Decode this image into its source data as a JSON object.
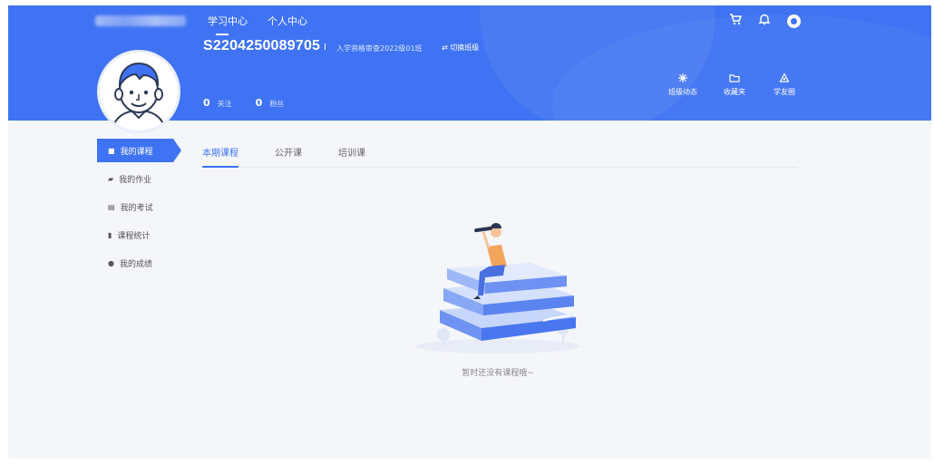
{
  "header": {
    "nav": [
      {
        "label": "学习中心"
      },
      {
        "label": "个人中心"
      }
    ],
    "username": "S2204250089705",
    "separator": "I",
    "class_name": "入学资格审查2022级01班",
    "switch_label": "⇄ 切换班级",
    "stats": [
      {
        "value": "0",
        "label": "关注"
      },
      {
        "value": "0",
        "label": "粉丝"
      }
    ],
    "quick_links": [
      {
        "label": "班级动态",
        "icon": "class-activity-icon"
      },
      {
        "label": "收藏夹",
        "icon": "folder-icon"
      },
      {
        "label": "学友圈",
        "icon": "friends-circle-icon"
      }
    ],
    "top_icons": [
      "cart-icon",
      "bell-icon",
      "user-avatar-icon"
    ]
  },
  "sidebar": {
    "items": [
      {
        "label": "我的课程",
        "icon": "course-icon"
      },
      {
        "label": "我的作业",
        "icon": "homework-icon"
      },
      {
        "label": "我的考试",
        "icon": "exam-icon"
      },
      {
        "label": "课程统计",
        "icon": "stats-icon"
      },
      {
        "label": "我的成绩",
        "icon": "grade-icon"
      }
    ]
  },
  "tabs": [
    {
      "label": "本期课程"
    },
    {
      "label": "公开课"
    },
    {
      "label": "培训课"
    }
  ],
  "empty": {
    "message": "暂时还没有课程哦~"
  },
  "colors": {
    "primary": "#3f73f3",
    "background": "#f5f6fa"
  }
}
